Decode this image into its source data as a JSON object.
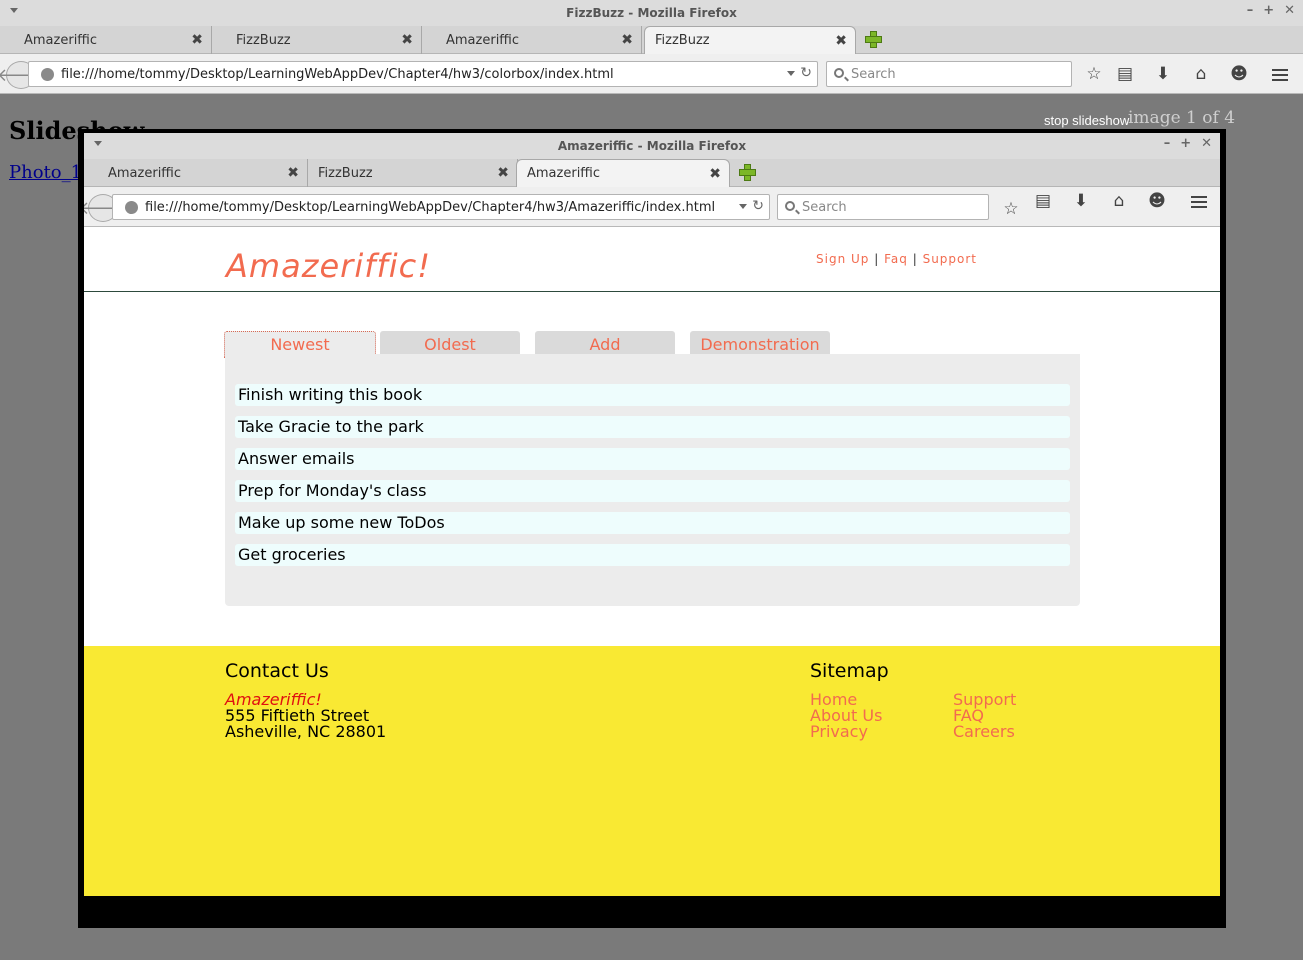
{
  "outer_window": {
    "title": "FizzBuzz - Mozilla Firefox",
    "tabs": [
      {
        "label": "Amazeriffic"
      },
      {
        "label": "FizzBuzz"
      },
      {
        "label": "Amazeriffic"
      },
      {
        "label": "FizzBuzz"
      }
    ],
    "url": "file:///home/tommy/Desktop/LearningWebAppDev/Chapter4/hw3/colorbox/index.html",
    "search_placeholder": "Search"
  },
  "outer_page": {
    "heading": "Slideshow",
    "photo_link": "Photo_1",
    "stop_slideshow": "stop slideshow",
    "image_counter": "image 1 of 4"
  },
  "inner_window": {
    "title": "Amazeriffic - Mozilla Firefox",
    "tabs": [
      {
        "label": "Amazeriffic"
      },
      {
        "label": "FizzBuzz"
      },
      {
        "label": "Amazeriffic"
      }
    ],
    "url": "file:///home/tommy/Desktop/LearningWebAppDev/Chapter4/hw3/Amazeriffic/index.html",
    "search_placeholder": "Search"
  },
  "amazeriffic": {
    "logo": "Amazeriffic!",
    "nav": {
      "signup": "Sign Up",
      "faq": "Faq",
      "support": "Support",
      "sep": "|"
    },
    "tabs": [
      "Newest",
      "Oldest",
      "Add",
      "Demonstration"
    ],
    "todos": [
      "Finish writing this book",
      "Take Gracie to the park",
      "Answer emails",
      "Prep for Monday's class",
      "Make up some new ToDos",
      "Get groceries"
    ],
    "footer": {
      "contact_heading": "Contact Us",
      "company": "Amazeriffic!",
      "street": "555 Fiftieth Street",
      "city": "Asheville, NC 28801",
      "sitemap_heading": "Sitemap",
      "links_col1": [
        "Home",
        "About Us",
        "Privacy"
      ],
      "links_col2": [
        "Support",
        "FAQ",
        "Careers"
      ]
    }
  },
  "colors": {
    "accent": "#f26b4f",
    "footer_bg": "#f9e933",
    "todo_bg": "#eefdfd",
    "panel_bg": "#ececec"
  }
}
